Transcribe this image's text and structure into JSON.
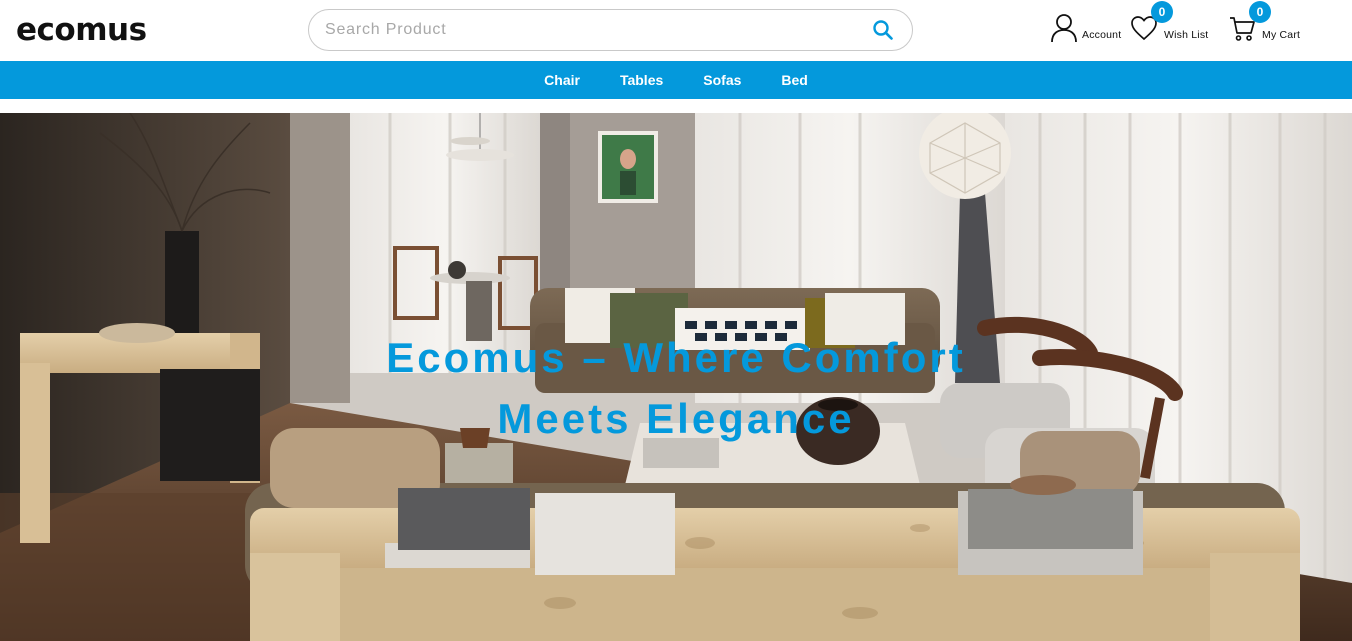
{
  "header": {
    "logo": "ecomus",
    "search": {
      "placeholder": "Search Product",
      "value": "",
      "icon": "search-icon"
    },
    "account": {
      "label": "Account",
      "icon": "user-icon"
    },
    "wishlist": {
      "label": "Wish List",
      "count": "0",
      "icon": "heart-icon"
    },
    "cart": {
      "label": "My Cart",
      "count": "0",
      "icon": "cart-icon"
    }
  },
  "nav": {
    "items": [
      {
        "label": "Chair"
      },
      {
        "label": "Tables"
      },
      {
        "label": "Sofas"
      },
      {
        "label": "Bed"
      }
    ]
  },
  "hero": {
    "title_line1": "Ecomus – Where Comfort",
    "title_line2": "Meets Elegance",
    "image": "living-room-photo"
  },
  "colors": {
    "accent": "#0499dc",
    "text": "#111111",
    "nav_text": "#ffffff"
  }
}
